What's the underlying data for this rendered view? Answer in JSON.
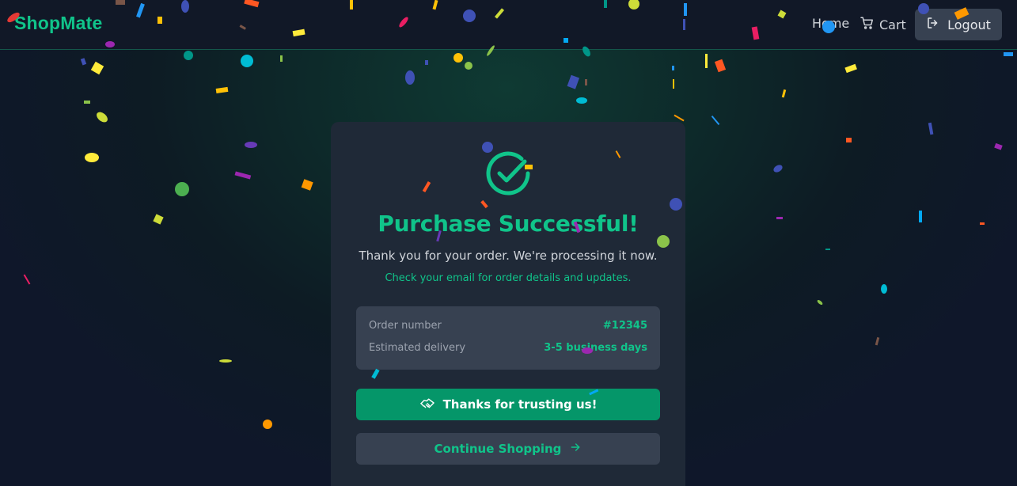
{
  "navbar": {
    "brand": "ShopMate",
    "links": {
      "home": "Home",
      "cart": "Cart"
    },
    "logout_label": "Logout",
    "icons": {
      "cart": "cart-icon",
      "logout": "logout-icon"
    }
  },
  "card": {
    "icon": "check-circle-icon",
    "title": "Purchase Successful!",
    "subtitle": "Thank you for your order. We're processing it now.",
    "hint": "Check your email for order details and updates.",
    "details": {
      "order_number_label": "Order number",
      "order_number_value": "#12345",
      "delivery_label": "Estimated delivery",
      "delivery_value": "3-5 business days"
    },
    "primary_button": {
      "label": "Thanks for trusting us!",
      "icon": "handshake-icon"
    },
    "secondary_button": {
      "label": "Continue Shopping",
      "icon": "arrow-right-icon"
    }
  },
  "colors": {
    "accent": "#10c48a",
    "button_primary": "#059669",
    "card_bg": "#1f2937",
    "panel_bg": "#374151",
    "navbar_bg": "#111827"
  }
}
